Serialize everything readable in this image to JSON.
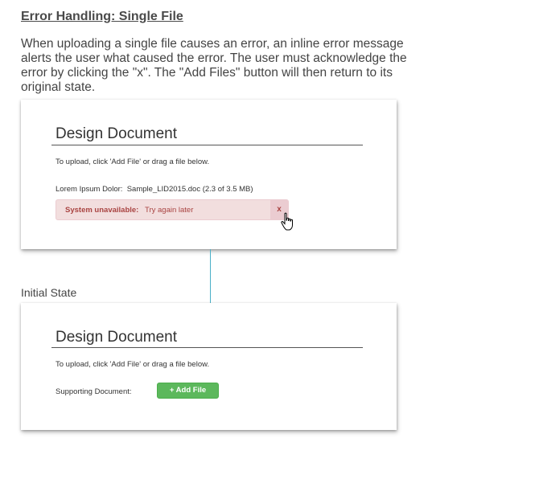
{
  "heading": "Error Handling: Single File",
  "intro": "When uploading a single file causes an error, an inline error message alerts the user what caused the error. The user must acknowledge the error by clicking the \"x\". The \"Add Files\" button will then return to its original state.",
  "error_card": {
    "title": "Design Document",
    "instruction": "To upload, click 'Add File' or drag a file below.",
    "file_label": "Lorem Ipsum Dolor:",
    "file_name": "Sample_LID2015.doc (2.3 of 3.5 MB)",
    "error_label": "System unavailable:",
    "error_message": "Try again later",
    "close_label": "x"
  },
  "state_label": "Initial State",
  "initial_card": {
    "title": "Design Document",
    "instruction": "To upload, click 'Add File' or drag a file below.",
    "field_label": "Supporting Document:",
    "add_button_label": "+ Add File"
  },
  "colors": {
    "error_bg": "#f2dede",
    "error_text": "#a94442",
    "success_button": "#5cb85c",
    "connector": "#4ab0c8"
  },
  "icons": {
    "cursor": "hand-pointer-icon"
  }
}
